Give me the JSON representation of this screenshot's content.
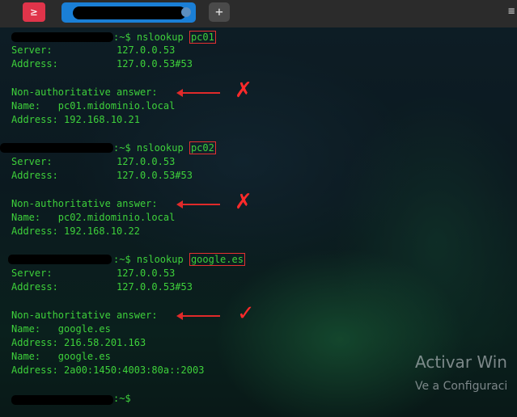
{
  "titlebar": {
    "app_icon_glyph": "≥",
    "new_tab_label": "+",
    "menu_label": "≡"
  },
  "prompt_suffix": ":~$ ",
  "queries": [
    {
      "cmd": "nslookup ",
      "target": "pc01",
      "server_label": "Server:",
      "server_value": "127.0.0.53",
      "address_label": "Address:",
      "address_value": "127.0.0.53#53",
      "answer_header": "Non-authoritative answer:",
      "result_mark": "✗",
      "records": [
        "Name:   pc01.midominio.local",
        "Address: 192.168.10.21"
      ]
    },
    {
      "cmd": "nslookup ",
      "target": "pc02",
      "server_label": "Server:",
      "server_value": "127.0.0.53",
      "address_label": "Address:",
      "address_value": "127.0.0.53#53",
      "answer_header": "Non-authoritative answer:",
      "result_mark": "✗",
      "records": [
        "Name:   pc02.midominio.local",
        "Address: 192.168.10.22"
      ]
    },
    {
      "cmd": "nslookup ",
      "target": "google.es",
      "server_label": "Server:",
      "server_value": "127.0.0.53",
      "address_label": "Address:",
      "address_value": "127.0.0.53#53",
      "answer_header": "Non-authoritative answer:",
      "result_mark": "✓",
      "records": [
        "Name:   google.es",
        "Address: 216.58.201.163",
        "Name:   google.es",
        "Address: 2a00:1450:4003:80a::2003"
      ]
    }
  ],
  "final_prompt": ":~$",
  "watermark": {
    "title": "Activar Win",
    "subtitle": "Ve a Configuraci"
  },
  "colors": {
    "terminal_text": "#3ed13b",
    "annotation_red": "#e02a2a",
    "tab_active": "#1a7fd6"
  }
}
